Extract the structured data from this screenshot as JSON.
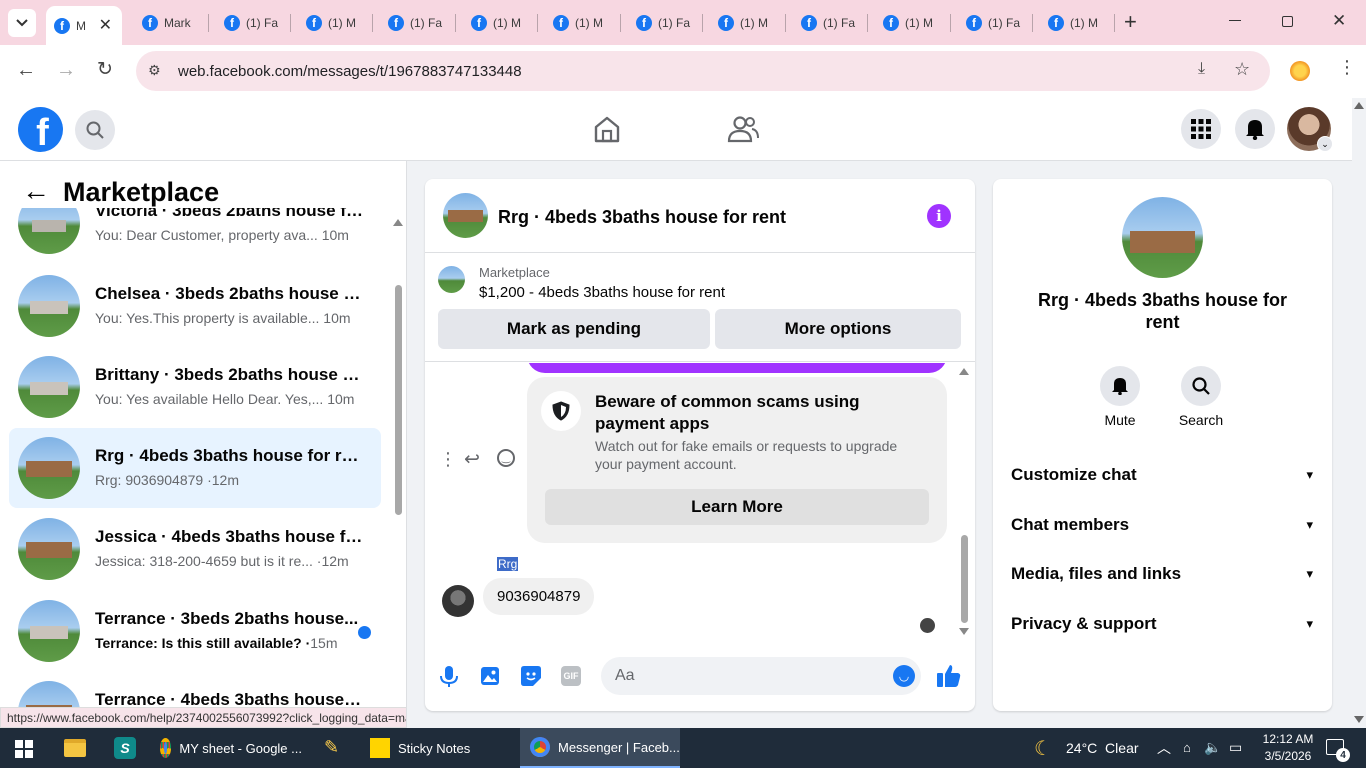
{
  "browser": {
    "tabs": [
      {
        "label": "M",
        "active": true
      },
      {
        "label": "Mark"
      },
      {
        "label": "(1) Fa"
      },
      {
        "label": "(1) M"
      },
      {
        "label": "(1) Fa"
      },
      {
        "label": "(1) M"
      },
      {
        "label": "(1) M"
      },
      {
        "label": "(1) Fa"
      },
      {
        "label": "(1) M"
      },
      {
        "label": "(1) Fa"
      },
      {
        "label": "(1) M"
      },
      {
        "label": "(1) Fa"
      },
      {
        "label": "(1) M"
      }
    ],
    "url": "web.facebook.com/messages/t/1967883747133448",
    "status_url": "https://www.facebook.com/help/2374002556073992?click_logging_data=mark..."
  },
  "sidebar": {
    "title": "Marketplace",
    "conversations": [
      {
        "title": "Victoria · 3beds 2baths house fo...",
        "preview": "You: Dear Customer, property ava...",
        "time": "10m"
      },
      {
        "title": "Chelsea · 3beds 2baths house fo...",
        "preview": "You: Yes.This property is available...",
        "time": "10m"
      },
      {
        "title": "Brittany · 3beds 2baths house fo...",
        "preview": "You: Yes available Hello Dear. Yes,...",
        "time": "10m"
      },
      {
        "title": "Rrg · 4beds 3baths house for rent",
        "preview": "Rrg: 9036904879 ·",
        "time": "12m"
      },
      {
        "title": "Jessica · 4beds 3baths house for...",
        "preview": "Jessica: 318-200-4659 but is it re...",
        "time": "·12m"
      },
      {
        "title": "Terrance · 3beds 2baths house...",
        "preview": "Terrance: Is this still available? ·",
        "time": "15m"
      },
      {
        "title": "Terrance · 4beds 3baths house f...",
        "preview": "",
        "time": ""
      }
    ]
  },
  "chat": {
    "title": "Rrg · 4beds 3baths house for rent",
    "listing_source": "Marketplace",
    "listing_line": "$1,200 - 4beds 3baths house for rent",
    "mark_pending": "Mark as pending",
    "more_options": "More options",
    "scam_title": "Beware of common scams using payment apps",
    "scam_body": "Watch out for fake emails or requests to upgrade your payment account.",
    "learn_more": "Learn More",
    "sender": "Rrg",
    "message": "9036904879",
    "composer_placeholder": "Aa"
  },
  "info": {
    "title": "Rrg · 4beds 3baths house for rent",
    "mute": "Mute",
    "search": "Search",
    "sections": [
      "Customize chat",
      "Chat members",
      "Media, files and links",
      "Privacy & support"
    ]
  },
  "taskbar": {
    "apps": [
      "MY sheet - Google ...",
      "Sticky Notes",
      "Messenger | Faceb..."
    ],
    "weather": "24°C  Clear",
    "time": "12:12 AM",
    "date": "3/5/2026",
    "notification_count": "4"
  },
  "colors": {
    "fb_blue": "#1877f2",
    "purple": "#a033ff",
    "selected_row": "#e7f3ff"
  }
}
